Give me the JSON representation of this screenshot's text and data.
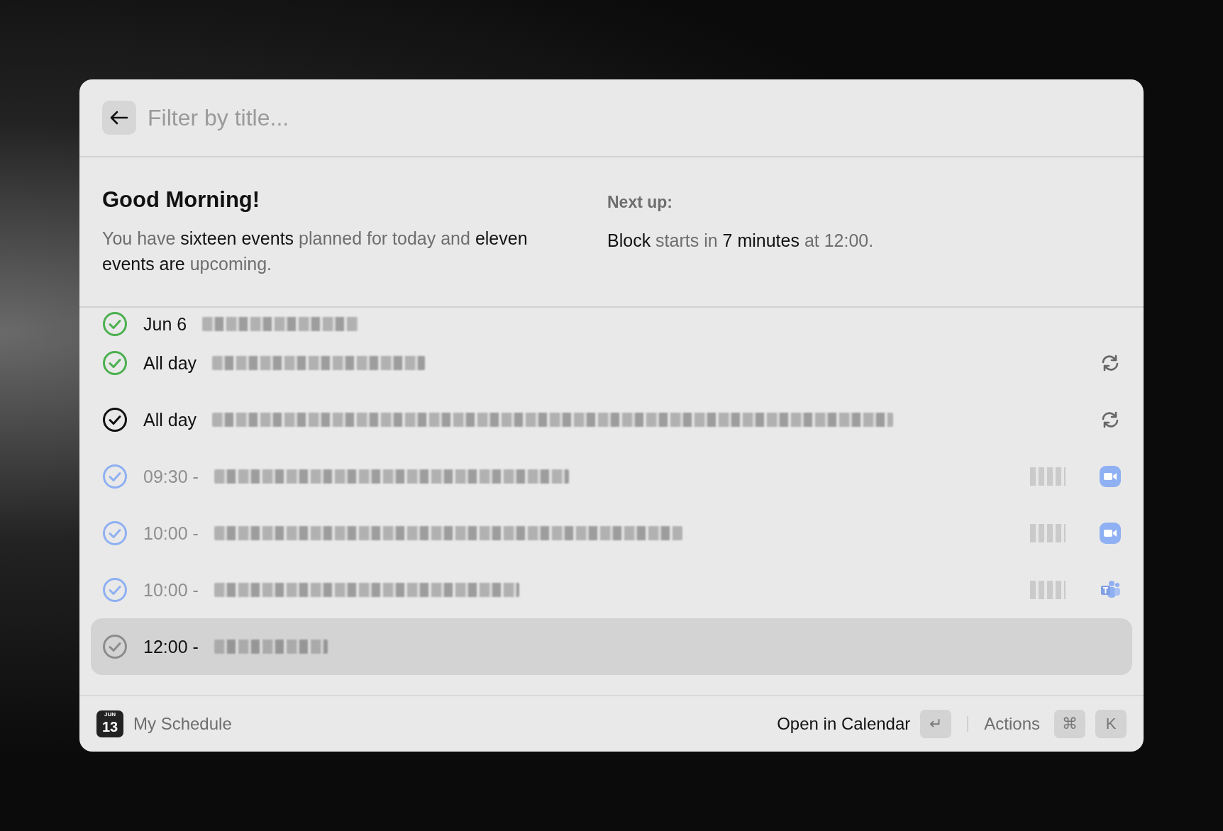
{
  "search": {
    "placeholder": "Filter by title..."
  },
  "summary": {
    "title": "Good Morning!",
    "text": "You have **sixteen events** planned for today and **eleven events are** upcoming.",
    "next_label": "Next up:",
    "next_text": "**Block** starts in **7 minutes** at 12:00."
  },
  "events": [
    {
      "kind": "plain",
      "time": "Jun 6",
      "color": "#4cb04f",
      "dimmed": false,
      "selected": false
    },
    {
      "kind": "recurring",
      "time": "All day",
      "color": "#4cb04f",
      "dimmed": false,
      "selected": false
    },
    {
      "kind": "recurring",
      "time": "All day",
      "color": "#111111",
      "dimmed": false,
      "selected": false
    },
    {
      "kind": "video",
      "time": "09:30 -",
      "color": "#8fb0f2",
      "dimmed": true,
      "selected": false
    },
    {
      "kind": "video",
      "time": "10:00 -",
      "color": "#8fb0f2",
      "dimmed": true,
      "selected": false
    },
    {
      "kind": "teams",
      "time": "10:00 -",
      "color": "#8fb0f2",
      "dimmed": true,
      "selected": false
    },
    {
      "kind": "plain",
      "time": "12:00 -",
      "color": "#8c8c8c",
      "dimmed": false,
      "selected": true
    }
  ],
  "footer": {
    "calendar_month": "JUN",
    "calendar_day": "13",
    "title": "My Schedule",
    "primary_action": "Open in Calendar",
    "primary_key": "↵",
    "actions_label": "Actions",
    "action_keys": [
      "⌘",
      "K"
    ]
  }
}
